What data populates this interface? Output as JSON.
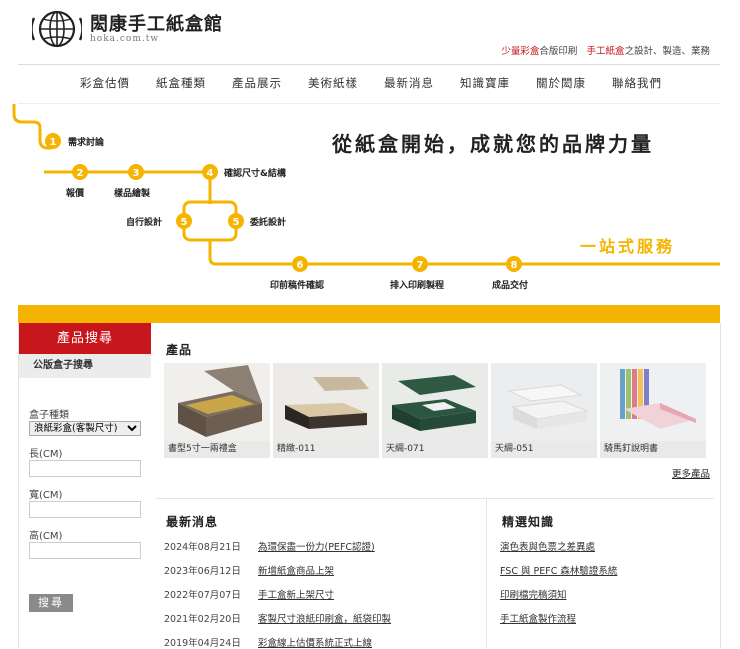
{
  "header": {
    "title": "閎康手工紙盒館",
    "subtitle": "hoka.com.tw",
    "slogan_part1": "少量彩盒",
    "slogan_part2": "合版印刷",
    "slogan_part3": "手工紙盒",
    "slogan_part4": "之設計、製造、業務"
  },
  "nav": {
    "items": [
      "彩盒估價",
      "紙盒種類",
      "產品展示",
      "美術紙樣",
      "最新消息",
      "知識寶庫",
      "關於閎康",
      "聯絡我們"
    ]
  },
  "process": {
    "headline": "從紙盒開始，成就您的品牌力量",
    "tagline": "一站式服務",
    "steps": [
      {
        "num": "1",
        "label": "需求討論"
      },
      {
        "num": "2",
        "label": "報價"
      },
      {
        "num": "3",
        "label": "樣品繪製"
      },
      {
        "num": "4",
        "label": "確認尺寸&結構"
      },
      {
        "num": "5",
        "label": "自行設計"
      },
      {
        "num": "5",
        "label": "委託設計"
      },
      {
        "num": "6",
        "label": "印前稿件確認"
      },
      {
        "num": "7",
        "label": "排入印刷製程"
      },
      {
        "num": "8",
        "label": "成品交付"
      }
    ],
    "accent_color": "#f5b400"
  },
  "sidebar": {
    "heading": "產品搜尋",
    "subheading": "公版盒子搜尋",
    "type_label": "盒子種類",
    "type_selected": "浪紙彩盒(客製尺寸)",
    "length_label": "長(CM)",
    "width_label": "寬(CM)",
    "height_label": "高(CM)",
    "search_label": "搜尋",
    "accent_color": "#c8161d"
  },
  "products": {
    "title": "產品",
    "items": [
      {
        "name": "書型5寸一兩禮盒"
      },
      {
        "name": "精緻-011"
      },
      {
        "name": "天綢-071"
      },
      {
        "name": "天綢-051"
      },
      {
        "name": "騎馬釘說明書"
      }
    ],
    "more_label": "更多產品"
  },
  "news": {
    "title": "最新消息",
    "items": [
      {
        "date": "2024年08月21日",
        "text": "為環保盡一份力(PEFC認證)"
      },
      {
        "date": "2023年06月12日",
        "text": "新增紙盒商品上架"
      },
      {
        "date": "2022年07月07日",
        "text": "手工盒新上架尺寸"
      },
      {
        "date": "2021年02月20日",
        "text": "客製尺寸浪紙印刷盒，紙袋印製"
      },
      {
        "date": "2019年04月24日",
        "text": "彩盒線上估價系統正式上線"
      }
    ]
  },
  "knowledge": {
    "title": "精選知識",
    "items": [
      "演色表與色票之差異處",
      "FSC 與 PEFC 森林驗證系統",
      "印刷檔完稿須知",
      "手工紙盒製作流程"
    ]
  }
}
